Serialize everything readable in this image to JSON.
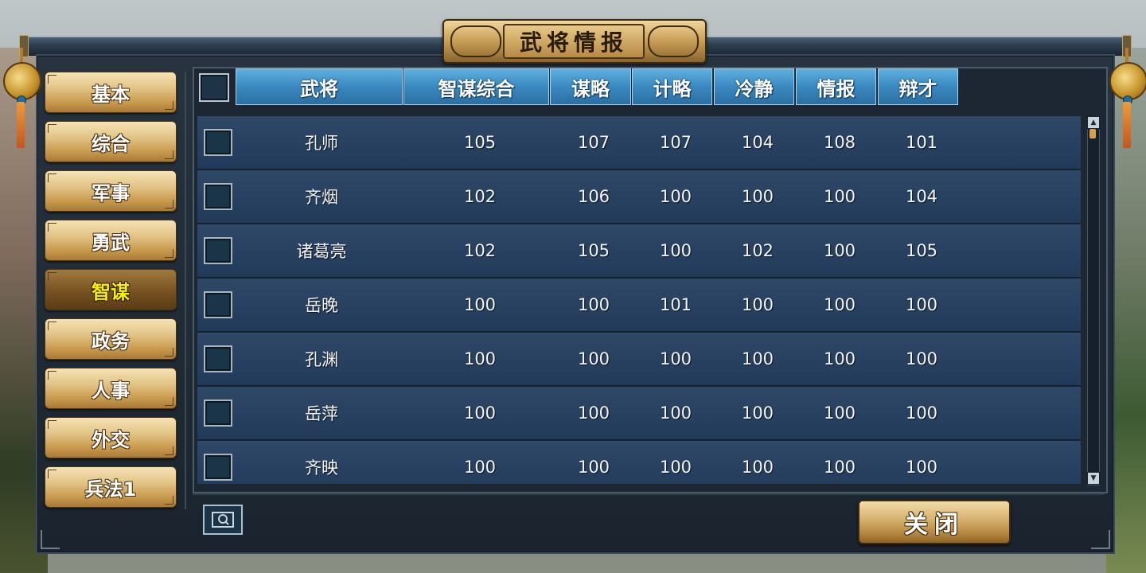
{
  "window": {
    "title": "武将情报"
  },
  "menu": {
    "items": [
      {
        "label": "基本",
        "active": false
      },
      {
        "label": "综合",
        "active": false
      },
      {
        "label": "军事",
        "active": false
      },
      {
        "label": "勇武",
        "active": false
      },
      {
        "label": "智谋",
        "active": true
      },
      {
        "label": "政务",
        "active": false
      },
      {
        "label": "人事",
        "active": false
      },
      {
        "label": "外交",
        "active": false
      },
      {
        "label": "兵法1",
        "active": false
      }
    ]
  },
  "table": {
    "headers": [
      "武将",
      "智谋综合",
      "谋略",
      "计略",
      "冷静",
      "情报",
      "辩才"
    ],
    "rows": [
      {
        "name": "孔师",
        "values": [
          "105",
          "107",
          "107",
          "104",
          "108",
          "101"
        ]
      },
      {
        "name": "齐烟",
        "values": [
          "102",
          "106",
          "100",
          "100",
          "100",
          "104"
        ]
      },
      {
        "name": "诸葛亮",
        "values": [
          "102",
          "105",
          "100",
          "102",
          "100",
          "105"
        ]
      },
      {
        "name": "岳晚",
        "values": [
          "100",
          "100",
          "101",
          "100",
          "100",
          "100"
        ]
      },
      {
        "name": "孔渊",
        "values": [
          "100",
          "100",
          "100",
          "100",
          "100",
          "100"
        ]
      },
      {
        "name": "岳萍",
        "values": [
          "100",
          "100",
          "100",
          "100",
          "100",
          "100"
        ]
      },
      {
        "name": "齐映",
        "values": [
          "100",
          "100",
          "100",
          "100",
          "100",
          "100"
        ]
      }
    ]
  },
  "footer": {
    "close_label": "关闭",
    "search_icon": "search-icon"
  },
  "colors": {
    "header_blue": "#3a88c0",
    "row_blue": "#274060",
    "gold": "#c99a4e",
    "active_text": "#f4f000"
  }
}
